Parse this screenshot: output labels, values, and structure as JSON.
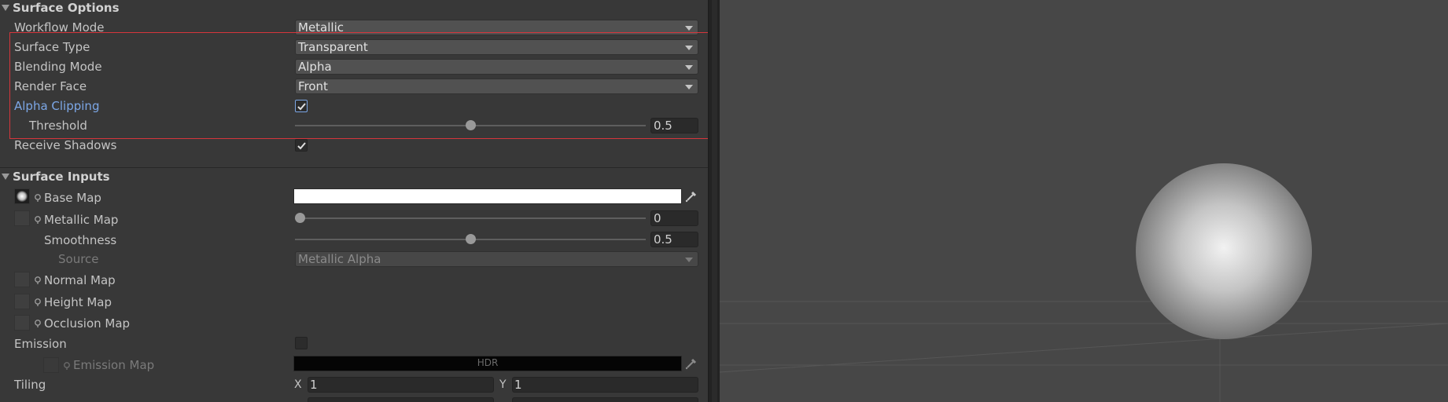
{
  "surface_options": {
    "header": "Surface Options",
    "workflow_mode": {
      "label": "Workflow Mode",
      "value": "Metallic"
    },
    "surface_type": {
      "label": "Surface Type",
      "value": "Transparent"
    },
    "blending_mode": {
      "label": "Blending Mode",
      "value": "Alpha"
    },
    "render_face": {
      "label": "Render Face",
      "value": "Front"
    },
    "alpha_clipping": {
      "label": "Alpha Clipping",
      "checked": true
    },
    "threshold": {
      "label": "Threshold",
      "value": "0.5",
      "fraction": 0.5
    },
    "receive_shadows": {
      "label": "Receive Shadows",
      "checked": true
    }
  },
  "surface_inputs": {
    "header": "Surface Inputs",
    "base_map": {
      "label": "Base Map",
      "color": "#ffffff"
    },
    "metallic_map": {
      "label": "Metallic Map",
      "value": "0",
      "fraction": 0.0
    },
    "smoothness": {
      "label": "Smoothness",
      "value": "0.5",
      "fraction": 0.5
    },
    "source": {
      "label": "Source",
      "value": "Metallic Alpha"
    },
    "normal_map": {
      "label": "Normal Map"
    },
    "height_map": {
      "label": "Height Map"
    },
    "occlusion_map": {
      "label": "Occlusion Map"
    },
    "emission": {
      "label": "Emission",
      "checked": false
    },
    "emission_map": {
      "label": "Emission Map",
      "hdr": "HDR",
      "color": "#050505"
    },
    "tiling": {
      "label": "Tiling",
      "x_label": "X",
      "x": "1",
      "y_label": "Y",
      "y": "1"
    }
  },
  "colors": {
    "accent": "#7ca7e6",
    "highlight": "#d6363c",
    "panel_bg": "#383838",
    "viewport_bg": "#474747"
  }
}
